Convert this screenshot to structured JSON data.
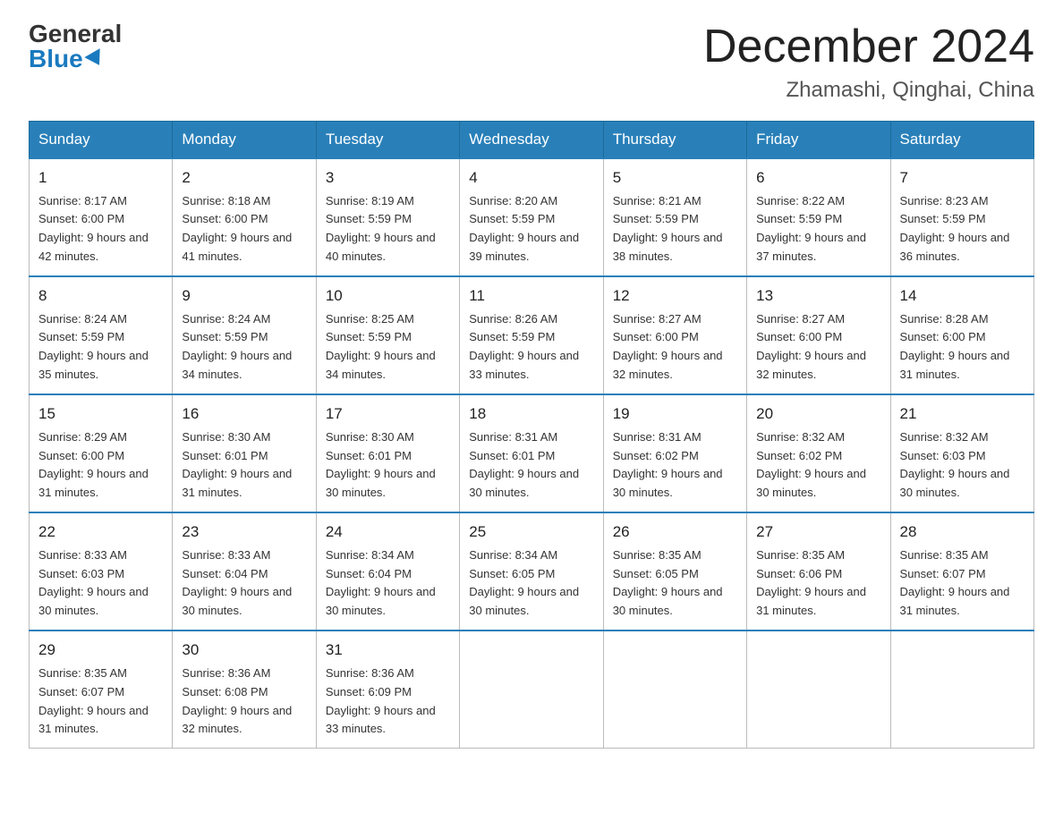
{
  "header": {
    "logo_general": "General",
    "logo_blue": "Blue",
    "month_title": "December 2024",
    "location": "Zhamashi, Qinghai, China"
  },
  "days_of_week": [
    "Sunday",
    "Monday",
    "Tuesday",
    "Wednesday",
    "Thursday",
    "Friday",
    "Saturday"
  ],
  "weeks": [
    [
      {
        "day": 1,
        "sunrise": "8:17 AM",
        "sunset": "6:00 PM",
        "daylight": "9 hours and 42 minutes."
      },
      {
        "day": 2,
        "sunrise": "8:18 AM",
        "sunset": "6:00 PM",
        "daylight": "9 hours and 41 minutes."
      },
      {
        "day": 3,
        "sunrise": "8:19 AM",
        "sunset": "5:59 PM",
        "daylight": "9 hours and 40 minutes."
      },
      {
        "day": 4,
        "sunrise": "8:20 AM",
        "sunset": "5:59 PM",
        "daylight": "9 hours and 39 minutes."
      },
      {
        "day": 5,
        "sunrise": "8:21 AM",
        "sunset": "5:59 PM",
        "daylight": "9 hours and 38 minutes."
      },
      {
        "day": 6,
        "sunrise": "8:22 AM",
        "sunset": "5:59 PM",
        "daylight": "9 hours and 37 minutes."
      },
      {
        "day": 7,
        "sunrise": "8:23 AM",
        "sunset": "5:59 PM",
        "daylight": "9 hours and 36 minutes."
      }
    ],
    [
      {
        "day": 8,
        "sunrise": "8:24 AM",
        "sunset": "5:59 PM",
        "daylight": "9 hours and 35 minutes."
      },
      {
        "day": 9,
        "sunrise": "8:24 AM",
        "sunset": "5:59 PM",
        "daylight": "9 hours and 34 minutes."
      },
      {
        "day": 10,
        "sunrise": "8:25 AM",
        "sunset": "5:59 PM",
        "daylight": "9 hours and 34 minutes."
      },
      {
        "day": 11,
        "sunrise": "8:26 AM",
        "sunset": "5:59 PM",
        "daylight": "9 hours and 33 minutes."
      },
      {
        "day": 12,
        "sunrise": "8:27 AM",
        "sunset": "6:00 PM",
        "daylight": "9 hours and 32 minutes."
      },
      {
        "day": 13,
        "sunrise": "8:27 AM",
        "sunset": "6:00 PM",
        "daylight": "9 hours and 32 minutes."
      },
      {
        "day": 14,
        "sunrise": "8:28 AM",
        "sunset": "6:00 PM",
        "daylight": "9 hours and 31 minutes."
      }
    ],
    [
      {
        "day": 15,
        "sunrise": "8:29 AM",
        "sunset": "6:00 PM",
        "daylight": "9 hours and 31 minutes."
      },
      {
        "day": 16,
        "sunrise": "8:30 AM",
        "sunset": "6:01 PM",
        "daylight": "9 hours and 31 minutes."
      },
      {
        "day": 17,
        "sunrise": "8:30 AM",
        "sunset": "6:01 PM",
        "daylight": "9 hours and 30 minutes."
      },
      {
        "day": 18,
        "sunrise": "8:31 AM",
        "sunset": "6:01 PM",
        "daylight": "9 hours and 30 minutes."
      },
      {
        "day": 19,
        "sunrise": "8:31 AM",
        "sunset": "6:02 PM",
        "daylight": "9 hours and 30 minutes."
      },
      {
        "day": 20,
        "sunrise": "8:32 AM",
        "sunset": "6:02 PM",
        "daylight": "9 hours and 30 minutes."
      },
      {
        "day": 21,
        "sunrise": "8:32 AM",
        "sunset": "6:03 PM",
        "daylight": "9 hours and 30 minutes."
      }
    ],
    [
      {
        "day": 22,
        "sunrise": "8:33 AM",
        "sunset": "6:03 PM",
        "daylight": "9 hours and 30 minutes."
      },
      {
        "day": 23,
        "sunrise": "8:33 AM",
        "sunset": "6:04 PM",
        "daylight": "9 hours and 30 minutes."
      },
      {
        "day": 24,
        "sunrise": "8:34 AM",
        "sunset": "6:04 PM",
        "daylight": "9 hours and 30 minutes."
      },
      {
        "day": 25,
        "sunrise": "8:34 AM",
        "sunset": "6:05 PM",
        "daylight": "9 hours and 30 minutes."
      },
      {
        "day": 26,
        "sunrise": "8:35 AM",
        "sunset": "6:05 PM",
        "daylight": "9 hours and 30 minutes."
      },
      {
        "day": 27,
        "sunrise": "8:35 AM",
        "sunset": "6:06 PM",
        "daylight": "9 hours and 31 minutes."
      },
      {
        "day": 28,
        "sunrise": "8:35 AM",
        "sunset": "6:07 PM",
        "daylight": "9 hours and 31 minutes."
      }
    ],
    [
      {
        "day": 29,
        "sunrise": "8:35 AM",
        "sunset": "6:07 PM",
        "daylight": "9 hours and 31 minutes."
      },
      {
        "day": 30,
        "sunrise": "8:36 AM",
        "sunset": "6:08 PM",
        "daylight": "9 hours and 32 minutes."
      },
      {
        "day": 31,
        "sunrise": "8:36 AM",
        "sunset": "6:09 PM",
        "daylight": "9 hours and 33 minutes."
      },
      null,
      null,
      null,
      null
    ]
  ]
}
